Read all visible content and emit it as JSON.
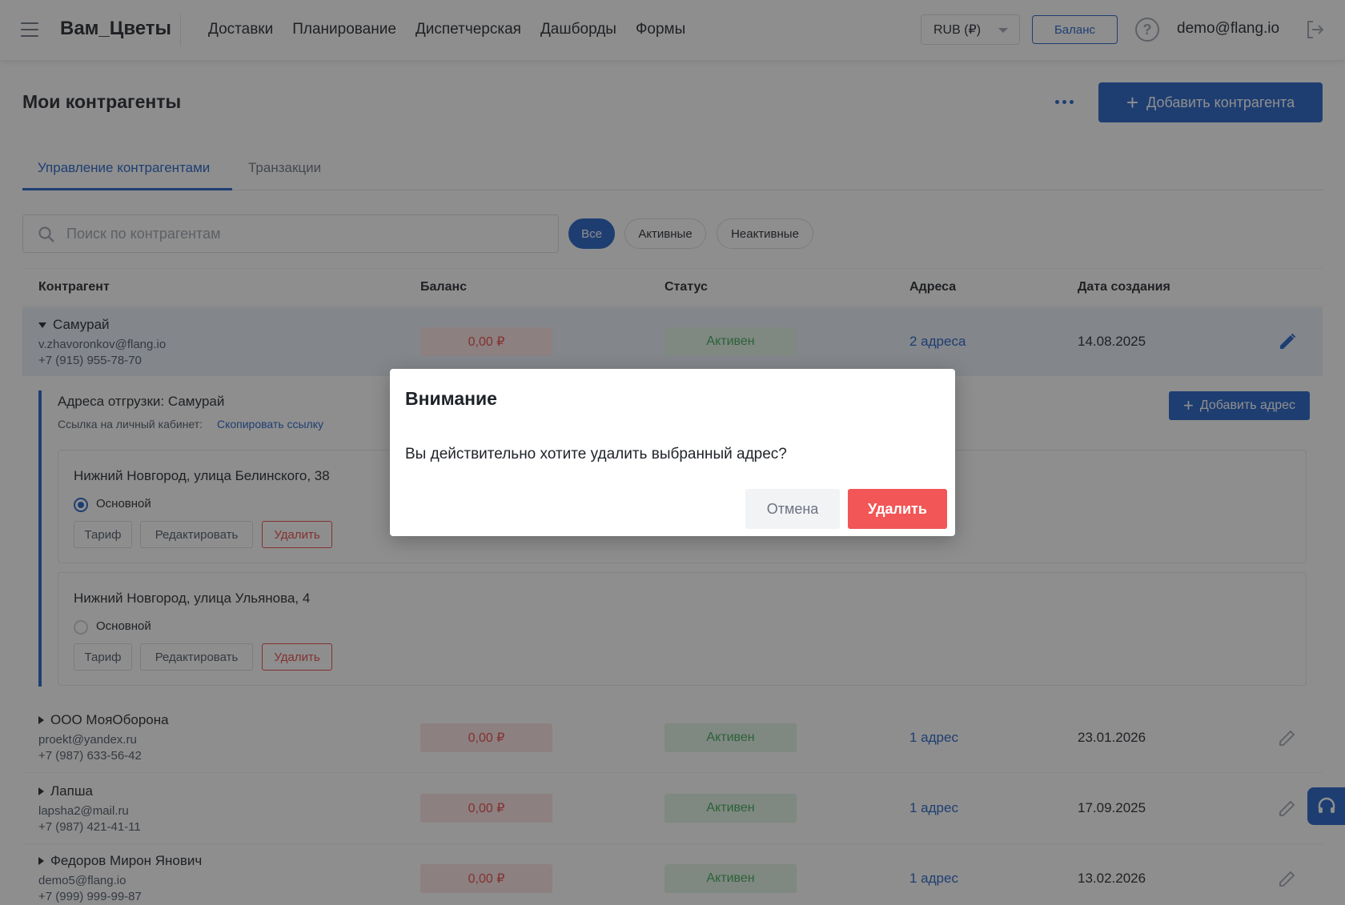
{
  "header": {
    "brand": "Вам_Цветы",
    "nav": [
      "Доставки",
      "Планирование",
      "Диспетчерская",
      "Дашборды",
      "Формы"
    ],
    "currency": "RUB (₽)",
    "balance_label": "Баланс",
    "help_symbol": "?",
    "user_email": "demo@flang.io"
  },
  "page": {
    "title": "Мои контрагенты",
    "add_label": "Добавить контрагента",
    "tabs": [
      "Управление контрагентами",
      "Транзакции"
    ],
    "search_placeholder": "Поиск по контрагентам",
    "filters": [
      "Все",
      "Активные",
      "Неактивные"
    ]
  },
  "table": {
    "columns": [
      "Контрагент",
      "Баланс",
      "Статус",
      "Адреса",
      "Дата создания"
    ],
    "rows": [
      {
        "name": "Самурай",
        "email": "v.zhavoronkov@flang.io",
        "phone": "+7 (915) 955-78-70",
        "balance": "0,00 ₽",
        "status": "Активен",
        "addresses": "2 адреса",
        "date": "14.08.2025"
      },
      {
        "name": "ООО МояОборона",
        "email": "proekt@yandex.ru",
        "phone": "+7 (987) 633-56-42",
        "balance": "0,00 ₽",
        "status": "Активен",
        "addresses": "1 адрес",
        "date": "23.01.2026"
      },
      {
        "name": "Лапша",
        "email": "lapsha2@mail.ru",
        "phone": "+7 (987) 421-41-11",
        "balance": "0,00 ₽",
        "status": "Активен",
        "addresses": "1 адрес",
        "date": "17.09.2025"
      },
      {
        "name": "Федоров Мирон Янович",
        "email": "demo5@flang.io",
        "phone": "+7 (999) 999-99-87",
        "balance": "0,00 ₽",
        "status": "Активен",
        "addresses": "1 адрес",
        "date": "13.02.2026"
      }
    ]
  },
  "addresses_panel": {
    "title": "Адреса отгрузки: Самурай",
    "link_label": "Ссылка на личный кабинет:",
    "copy_link": "Скопировать ссылку",
    "add_address": "Добавить адрес",
    "cards": [
      {
        "address": "Нижний Новгород, улица Белинского, 38",
        "primary_label": "Основной",
        "is_primary": true,
        "tariff": "Тариф",
        "edit": "Редактировать",
        "delete": "Удалить"
      },
      {
        "address": "Нижний Новгород, улица Ульянова, 4",
        "primary_label": "Основной",
        "is_primary": false,
        "tariff": "Тариф",
        "edit": "Редактировать",
        "delete": "Удалить"
      }
    ]
  },
  "modal": {
    "title": "Внимание",
    "message": "Вы действительно хотите удалить выбранный адрес?",
    "cancel": "Отмена",
    "confirm": "Удалить"
  },
  "colors": {
    "accent": "#1f5fc7",
    "danger": "#f25656",
    "success": "#3aa655"
  }
}
